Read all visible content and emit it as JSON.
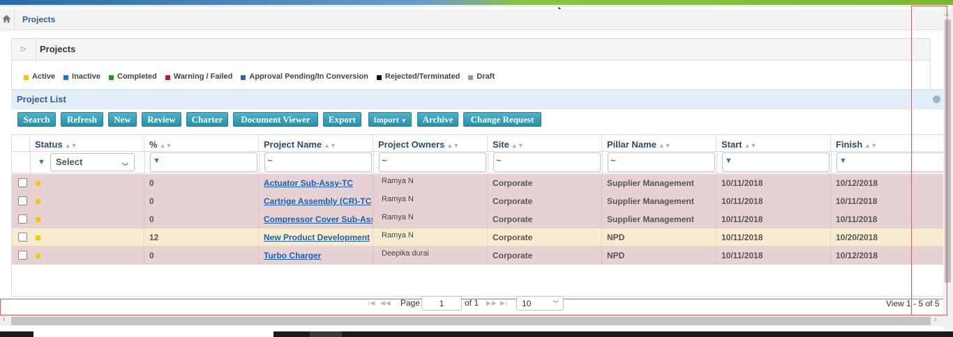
{
  "breadcrumb": {
    "current": "Projects"
  },
  "panel": {
    "title": "Projects"
  },
  "legend": [
    {
      "label": "Active",
      "color": "#f2c618"
    },
    {
      "label": "Inactive",
      "color": "#1e73d8"
    },
    {
      "label": "Completed",
      "color": "#2e8b2e"
    },
    {
      "label": "Warning / Failed",
      "color": "#b22222"
    },
    {
      "label": "Approval Pending/In Conversion",
      "color": "#2f5fa8"
    },
    {
      "label": "Rejected/Terminated",
      "color": "#111111"
    },
    {
      "label": "Draft",
      "color": "#999999"
    }
  ],
  "list": {
    "title": "Project List"
  },
  "toolbar": {
    "search": "Search",
    "refresh": "Refresh",
    "new": "New",
    "review": "Review",
    "charter": "Charter",
    "document_viewer": "Document Viewer",
    "export": "Export",
    "import": "Import",
    "archive": "Archive",
    "change_request": "Change Request"
  },
  "columns": {
    "status": "Status",
    "percent": "%",
    "project_name": "Project Name",
    "project_owners": "Project Owners",
    "site": "Site",
    "pillar_name": "Pillar Name",
    "start": "Start",
    "finish": "Finish"
  },
  "filters": {
    "status_select": "Select",
    "tilde": "~"
  },
  "rows": [
    {
      "percent": "0",
      "name": "Actuator Sub-Assy-TC",
      "owner": "Ramya N",
      "site": "Corporate",
      "pillar": "Supplier Management",
      "start": "10/11/2018",
      "finish": "10/12/2018"
    },
    {
      "percent": "0",
      "name": "Cartrige Assembly (CR)-TC",
      "owner": "Ramya N",
      "site": "Corporate",
      "pillar": "Supplier Management",
      "start": "10/11/2018",
      "finish": "10/11/2018"
    },
    {
      "percent": "0",
      "name": "Compressor Cover Sub-Asse",
      "owner": "Ramya N",
      "site": "Corporate",
      "pillar": "Supplier Management",
      "start": "10/11/2018",
      "finish": "10/11/2018"
    },
    {
      "percent": "12",
      "name": "New Product Development",
      "owner": "Ramya N",
      "site": "Corporate",
      "pillar": "NPD",
      "start": "10/11/2018",
      "finish": "10/20/2018"
    },
    {
      "percent": "0",
      "name": "Turbo Charger",
      "owner": "Deepika durai",
      "site": "Corporate",
      "pillar": "NPD",
      "start": "10/11/2018",
      "finish": "10/12/2018"
    }
  ],
  "pager": {
    "page_label": "Page",
    "page_value": "1",
    "of_label": "of 1",
    "page_size": "10",
    "view_text": "View 1 - 5 of 5"
  }
}
